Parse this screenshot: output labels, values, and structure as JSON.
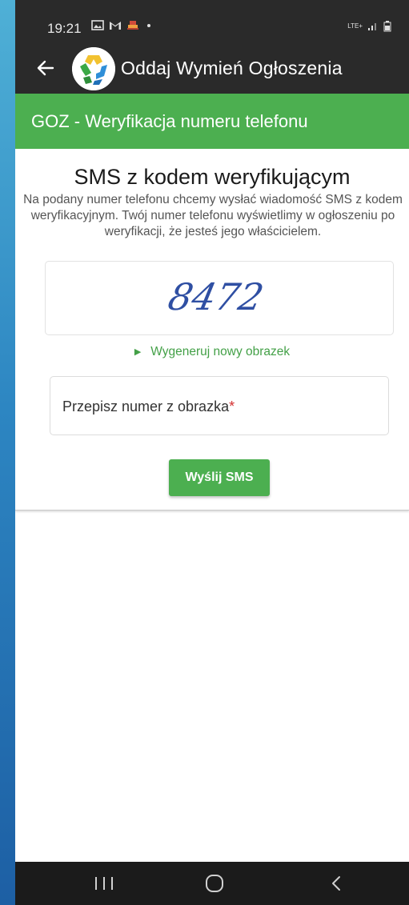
{
  "status_bar": {
    "time": "19:21",
    "left_icons": [
      "gallery-icon",
      "gmail-icon",
      "app-notification-icon",
      "dot-icon"
    ],
    "right_icons": [
      "lte-icon",
      "signal-icon",
      "battery-icon"
    ],
    "network": "LTE+"
  },
  "app_bar": {
    "title": "Oddaj Wymień Ogłoszenia",
    "back_icon": "arrow-left-icon",
    "logo_icon": "recycle-logo-icon"
  },
  "page_header": {
    "title": "GOZ - Weryfikacja numeru telefonu"
  },
  "card": {
    "title": "SMS z kodem weryfikującym",
    "description": "Na podany numer telefonu chcemy wysłać wiadomość SMS z kodem weryfikacyjnym. Twój numer telefonu wyświetlimy w ogłoszeniu po weryfikacji, że jesteś jego właścicielem.",
    "captcha_text": "8472",
    "regenerate_link": "Wygeneruj nowy obrazek",
    "code_input": {
      "placeholder": "Przepisz numer z obrazka",
      "required_mark": "*",
      "value": ""
    },
    "send_button": "Wyślij SMS"
  },
  "colors": {
    "accent_green": "#4caf50",
    "link_green": "#43a047",
    "dark_bar": "#2a2a2a",
    "required_red": "#d32f2f",
    "captcha_blue": "#2f4fa3"
  },
  "nav_bar": {
    "icons": [
      "recent-apps-icon",
      "home-icon",
      "back-icon"
    ]
  }
}
